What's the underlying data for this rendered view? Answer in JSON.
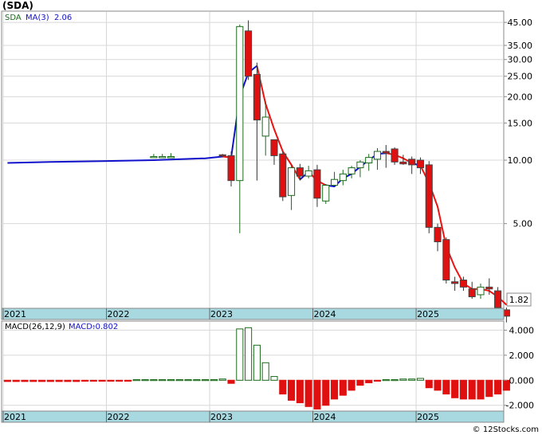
{
  "title": "(SDA)",
  "price_panel": {
    "legend": {
      "symbol": "SDA",
      "ma_label": "MA(3)",
      "ma_value": "2.06"
    },
    "last_price": "1.82",
    "y_ticks": [
      "45.00",
      "35.00",
      "30.00",
      "25.00",
      "20.00",
      "15.00",
      "10.00",
      "5.00"
    ],
    "x_ticks": [
      "2021",
      "2022",
      "2023",
      "2024",
      "2025"
    ]
  },
  "macd_panel": {
    "legend": {
      "label": "MACD(26,12,9)",
      "macd_label": "MACD:",
      "macd_value": "-0.802"
    },
    "y_ticks": [
      "4.000",
      "2.000",
      "0.000",
      "-2.000"
    ],
    "x_ticks": [
      "2021",
      "2022",
      "2023",
      "2024",
      "2025"
    ]
  },
  "footer": {
    "copyright": "© 12Stocks.com"
  },
  "colors": {
    "up": "#1a6b1a",
    "down": "#e01010",
    "ma_blue": "#1111cc",
    "ma_red": "#ee1111",
    "axis_band": "#a8d8e0"
  },
  "chart_data": [
    {
      "type": "candlestick",
      "title": "(SDA)",
      "y_scale": "log",
      "ylim": [
        2.0,
        50.0
      ],
      "x_range": [
        "2021-01",
        "2025-10"
      ],
      "candles": [
        {
          "date": "2022-06",
          "open": 10.3,
          "high": 10.7,
          "low": 10.3,
          "close": 10.4
        },
        {
          "date": "2022-07",
          "open": 10.3,
          "high": 10.7,
          "low": 10.3,
          "close": 10.4
        },
        {
          "date": "2022-08",
          "open": 10.3,
          "high": 10.8,
          "low": 10.3,
          "close": 10.4
        },
        {
          "date": "2023-02",
          "open": 10.6,
          "high": 10.7,
          "low": 10.3,
          "close": 10.5
        },
        {
          "date": "2023-03",
          "open": 10.5,
          "high": 11.0,
          "low": 7.5,
          "close": 8.0
        },
        {
          "date": "2023-04",
          "open": 8.0,
          "high": 44.0,
          "low": 4.5,
          "close": 43.0
        },
        {
          "date": "2023-05",
          "open": 41.0,
          "high": 46.0,
          "low": 24.0,
          "close": 25.0
        },
        {
          "date": "2023-06",
          "open": 25.5,
          "high": 29.0,
          "low": 8.0,
          "close": 15.5
        },
        {
          "date": "2023-07",
          "open": 13.0,
          "high": 19.0,
          "low": 10.5,
          "close": 16.0
        },
        {
          "date": "2023-08",
          "open": 12.5,
          "high": 12.5,
          "low": 9.5,
          "close": 10.5
        },
        {
          "date": "2023-09",
          "open": 10.7,
          "high": 11.0,
          "low": 6.4,
          "close": 6.7
        },
        {
          "date": "2023-10",
          "open": 6.8,
          "high": 9.6,
          "low": 5.8,
          "close": 9.2
        },
        {
          "date": "2023-11",
          "open": 9.2,
          "high": 9.6,
          "low": 8.0,
          "close": 8.4
        },
        {
          "date": "2023-12",
          "open": 8.4,
          "high": 9.4,
          "low": 8.2,
          "close": 8.9
        },
        {
          "date": "2024-01",
          "open": 9.0,
          "high": 9.5,
          "low": 6.0,
          "close": 6.6
        },
        {
          "date": "2024-02",
          "open": 6.4,
          "high": 7.7,
          "low": 6.2,
          "close": 7.6
        },
        {
          "date": "2024-03",
          "open": 7.6,
          "high": 8.8,
          "low": 7.6,
          "close": 8.1
        },
        {
          "date": "2024-04",
          "open": 8.0,
          "high": 9.0,
          "low": 7.6,
          "close": 8.6
        },
        {
          "date": "2024-05",
          "open": 8.6,
          "high": 9.4,
          "low": 8.2,
          "close": 9.2
        },
        {
          "date": "2024-06",
          "open": 9.2,
          "high": 10.0,
          "low": 8.3,
          "close": 9.8
        },
        {
          "date": "2024-07",
          "open": 9.7,
          "high": 10.7,
          "low": 8.9,
          "close": 10.3
        },
        {
          "date": "2024-08",
          "open": 10.1,
          "high": 11.4,
          "low": 9.0,
          "close": 11.0
        },
        {
          "date": "2024-09",
          "open": 11.0,
          "high": 11.8,
          "low": 9.2,
          "close": 10.8
        },
        {
          "date": "2024-10",
          "open": 11.3,
          "high": 11.5,
          "low": 9.5,
          "close": 9.8
        },
        {
          "date": "2024-11",
          "open": 9.8,
          "high": 10.6,
          "low": 9.5,
          "close": 9.6
        },
        {
          "date": "2024-12",
          "open": 10.1,
          "high": 10.4,
          "low": 8.6,
          "close": 9.5
        },
        {
          "date": "2025-01",
          "open": 10.0,
          "high": 10.3,
          "low": 8.6,
          "close": 9.2
        },
        {
          "date": "2025-02",
          "open": 9.5,
          "high": 9.9,
          "low": 4.5,
          "close": 4.8
        },
        {
          "date": "2025-03",
          "open": 4.8,
          "high": 5.0,
          "low": 3.7,
          "close": 4.1
        },
        {
          "date": "2025-04",
          "open": 4.2,
          "high": 4.3,
          "low": 2.6,
          "close": 2.7
        },
        {
          "date": "2025-05",
          "open": 2.65,
          "high": 2.8,
          "low": 2.4,
          "close": 2.6
        },
        {
          "date": "2025-06",
          "open": 2.7,
          "high": 2.8,
          "low": 2.4,
          "close": 2.5
        },
        {
          "date": "2025-07",
          "open": 2.45,
          "high": 2.65,
          "low": 2.2,
          "close": 2.25
        },
        {
          "date": "2025-08",
          "open": 2.3,
          "high": 2.6,
          "low": 2.2,
          "close": 2.5
        },
        {
          "date": "2025-09",
          "open": 2.5,
          "high": 2.75,
          "low": 2.3,
          "close": 2.45
        },
        {
          "date": "2025-10",
          "open": 2.4,
          "high": 2.5,
          "low": 1.95,
          "close": 2.0
        },
        {
          "date": "2025-11",
          "open": 1.95,
          "high": 2.0,
          "low": 1.7,
          "close": 1.82
        }
      ],
      "ma_series": {
        "name": "MA(3)",
        "x": [
          "2021-01",
          "2021-06",
          "2021-12",
          "2022-06",
          "2022-12",
          "2023-02",
          "2023-03",
          "2023-04",
          "2023-05",
          "2023-06",
          "2023-07",
          "2023-08",
          "2023-09",
          "2023-10",
          "2023-11",
          "2023-12",
          "2024-01",
          "2024-02",
          "2024-03",
          "2024-04",
          "2024-05",
          "2024-06",
          "2024-07",
          "2024-08",
          "2024-09",
          "2024-10",
          "2024-11",
          "2024-12",
          "2025-01",
          "2025-02",
          "2025-03",
          "2025-04",
          "2025-05",
          "2025-06",
          "2025-07",
          "2025-08",
          "2025-09",
          "2025-10",
          "2025-11"
        ],
        "y": [
          9.7,
          9.8,
          9.9,
          10.0,
          10.2,
          10.4,
          10.3,
          20.0,
          26.0,
          28.0,
          18.5,
          14.0,
          11.0,
          9.5,
          8.1,
          8.8,
          8.0,
          7.6,
          7.5,
          8.2,
          8.6,
          9.3,
          10.0,
          10.7,
          10.8,
          10.6,
          10.2,
          9.7,
          9.4,
          7.8,
          6.0,
          3.9,
          3.1,
          2.6,
          2.45,
          2.45,
          2.4,
          2.25,
          2.06
        ],
        "segments_color": [
          {
            "from": "2021-01",
            "to": "2023-02",
            "color": "blue"
          },
          {
            "from": "2023-02",
            "to": "2023-03",
            "color": "red"
          },
          {
            "from": "2023-03",
            "to": "2023-06",
            "color": "blue"
          },
          {
            "from": "2023-06",
            "to": "2023-11",
            "color": "red"
          },
          {
            "from": "2023-11",
            "to": "2023-12",
            "color": "blue"
          },
          {
            "from": "2023-12",
            "to": "2024-02",
            "color": "red"
          },
          {
            "from": "2024-02",
            "to": "2024-09",
            "color": "blue"
          },
          {
            "from": "2024-09",
            "to": "2024-12",
            "color": "red"
          },
          {
            "from": "2024-12",
            "to": "2025-01",
            "color": "blue"
          },
          {
            "from": "2025-01",
            "to": "2025-11",
            "color": "red"
          }
        ]
      },
      "x_ticks": [
        "2021",
        "2022",
        "2023",
        "2024",
        "2025"
      ],
      "y_ticks": [
        45,
        35,
        30,
        25,
        20,
        15,
        10,
        5
      ]
    },
    {
      "type": "bar",
      "title": "MACD(26,12,9)",
      "ylim": [
        -2.4,
        4.6
      ],
      "y_ticks": [
        4.0,
        2.0,
        0.0,
        -2.0
      ],
      "x": [
        "2021-01",
        "2021-02",
        "2021-03",
        "2021-04",
        "2021-05",
        "2021-06",
        "2021-07",
        "2021-08",
        "2021-09",
        "2021-10",
        "2021-11",
        "2021-12",
        "2022-01",
        "2022-02",
        "2022-03",
        "2022-04",
        "2022-05",
        "2022-06",
        "2022-07",
        "2022-08",
        "2022-09",
        "2022-10",
        "2022-11",
        "2022-12",
        "2023-01",
        "2023-02",
        "2023-03",
        "2023-04",
        "2023-05",
        "2023-06",
        "2023-07",
        "2023-08",
        "2023-09",
        "2023-10",
        "2023-11",
        "2023-12",
        "2024-01",
        "2024-02",
        "2024-03",
        "2024-04",
        "2024-05",
        "2024-06",
        "2024-07",
        "2024-08",
        "2024-09",
        "2024-10",
        "2024-11",
        "2024-12",
        "2025-01",
        "2025-02",
        "2025-03",
        "2025-04",
        "2025-05",
        "2025-06",
        "2025-07",
        "2025-08",
        "2025-09",
        "2025-10",
        "2025-11"
      ],
      "values": [
        -0.1,
        -0.1,
        -0.1,
        -0.1,
        -0.1,
        -0.1,
        -0.1,
        -0.1,
        -0.1,
        -0.05,
        -0.05,
        -0.05,
        -0.05,
        -0.05,
        -0.05,
        0.05,
        0.05,
        0.05,
        0.05,
        0.05,
        0.05,
        0.05,
        0.05,
        0.05,
        0.05,
        0.1,
        -0.25,
        4.1,
        4.2,
        2.8,
        1.4,
        0.3,
        -1.1,
        -1.6,
        -1.8,
        -2.1,
        -2.3,
        -2.0,
        -1.5,
        -1.2,
        -0.8,
        -0.4,
        -0.2,
        -0.05,
        0.05,
        0.05,
        0.1,
        0.1,
        0.15,
        -0.6,
        -0.8,
        -1.1,
        -1.4,
        -1.5,
        -1.5,
        -1.5,
        -1.3,
        -1.1,
        -0.8
      ]
    }
  ]
}
